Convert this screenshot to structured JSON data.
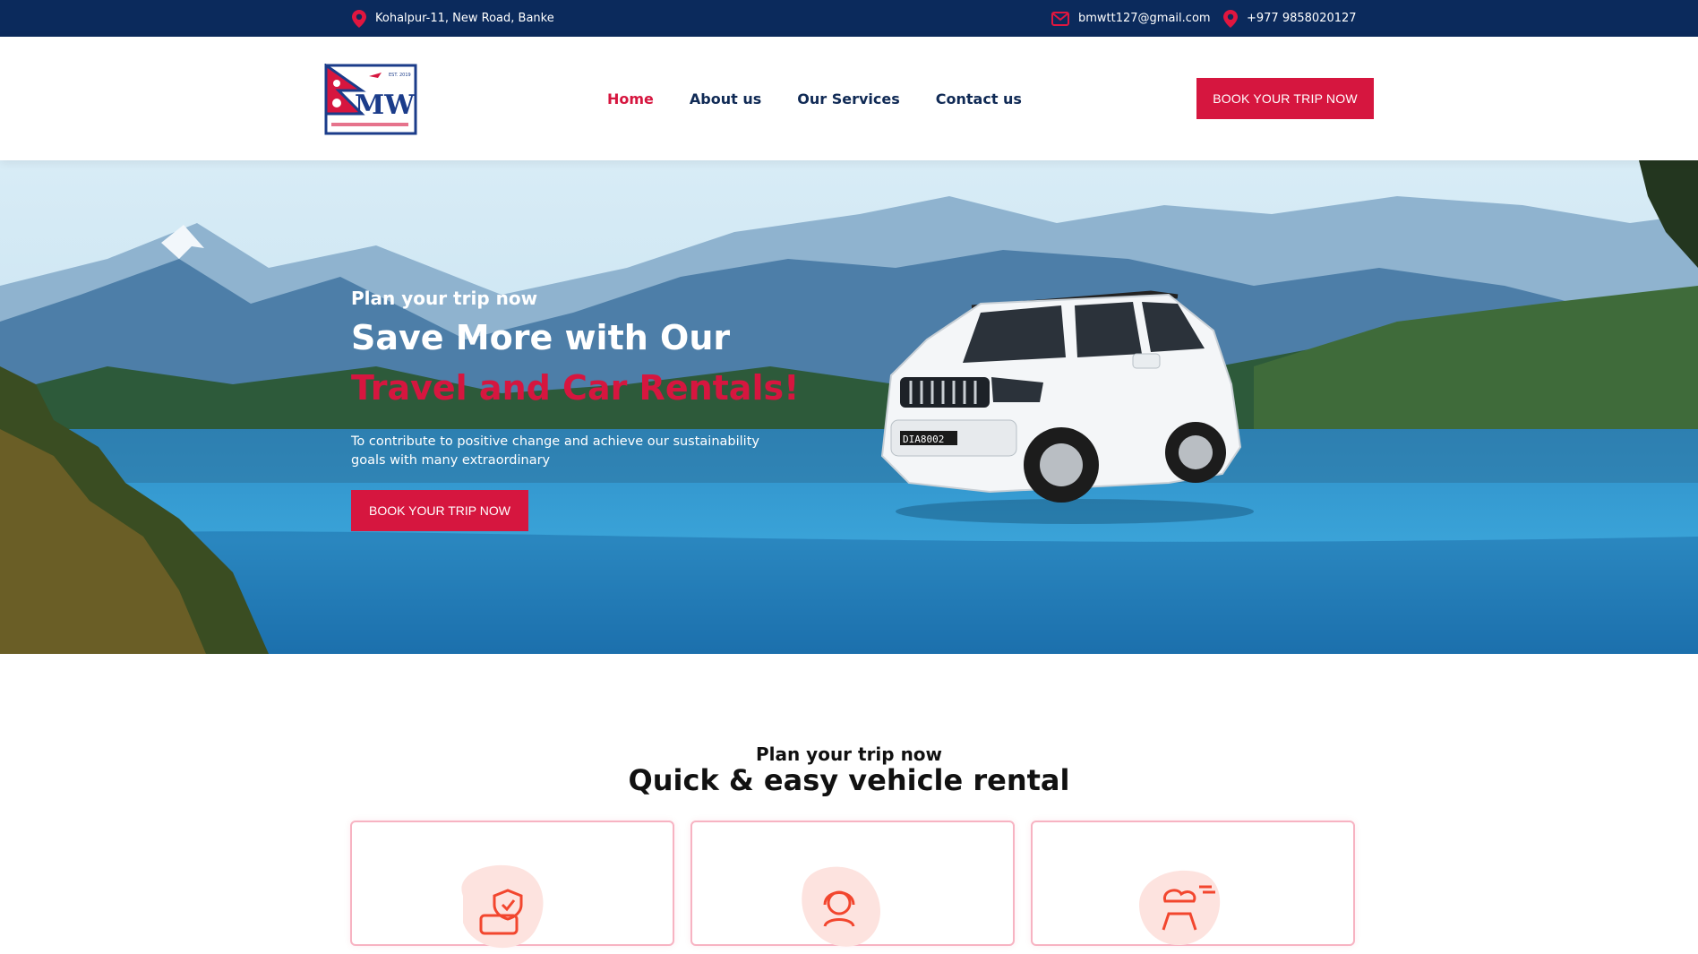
{
  "topbar": {
    "address": "Kohalpur-11, New Road, Banke",
    "email": "bmwtt127@gmail.com",
    "phone": "+977 9858020127",
    "address_icon": "map-pin-icon",
    "email_icon": "envelope-icon",
    "phone_icon": "map-pin-icon"
  },
  "header": {
    "logo_icon": "bmw-logo",
    "nav": [
      "Home",
      "About us",
      "Our Services",
      "Contact us"
    ],
    "active": "Home",
    "cta": "BOOK YOUR TRIP NOW"
  },
  "hero": {
    "eyebrow": "Plan your trip now",
    "title_line1": "Save More with Our",
    "title_line2": "Travel and Car Rentals!",
    "description": "To contribute to positive change and achieve our sustainability goals with many extraordinary",
    "cta": "BOOK YOUR TRIP NOW",
    "plate": "DIA8002"
  },
  "section": {
    "eyebrow": "Plan your trip now",
    "title": "Quick & easy vehicle rental",
    "cards": [
      {
        "icon": "car-shield-icon"
      },
      {
        "icon": "support-headset-icon"
      },
      {
        "icon": "delivery-cloud-icon"
      }
    ]
  },
  "colors": {
    "navy": "#0b2a5c",
    "accent": "#d6163f",
    "card_border": "#f7b3c2"
  }
}
